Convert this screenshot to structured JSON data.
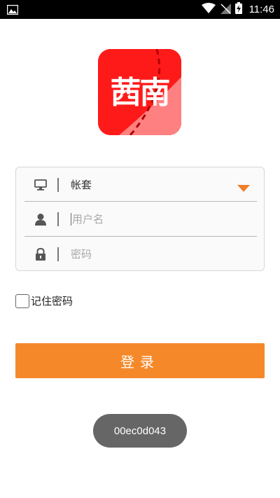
{
  "status_bar": {
    "time": "11:46",
    "left_icon": "image-icon",
    "right_icons": [
      "wifi-icon",
      "signal-off-icon",
      "battery-charging-icon"
    ]
  },
  "logo": {
    "text": "茜南",
    "icon": "star-icon",
    "colors": {
      "background": "#ff1a1a",
      "stripe": "#ff8080"
    }
  },
  "form": {
    "account": {
      "icon": "monitor-icon",
      "value": "帐套",
      "dropdown_icon": "triangle-down-icon"
    },
    "username": {
      "icon": "user-icon",
      "placeholder": "用户名"
    },
    "password": {
      "icon": "lock-icon",
      "placeholder": "密码"
    }
  },
  "remember": {
    "label": "记住密码",
    "checked": false
  },
  "login_button": {
    "label": "登录",
    "color": "#f5892a"
  },
  "toast": {
    "text": "00ec0d043"
  },
  "colors": {
    "accent": "#f5892a",
    "dropdown_accent": "#f07f2a"
  }
}
